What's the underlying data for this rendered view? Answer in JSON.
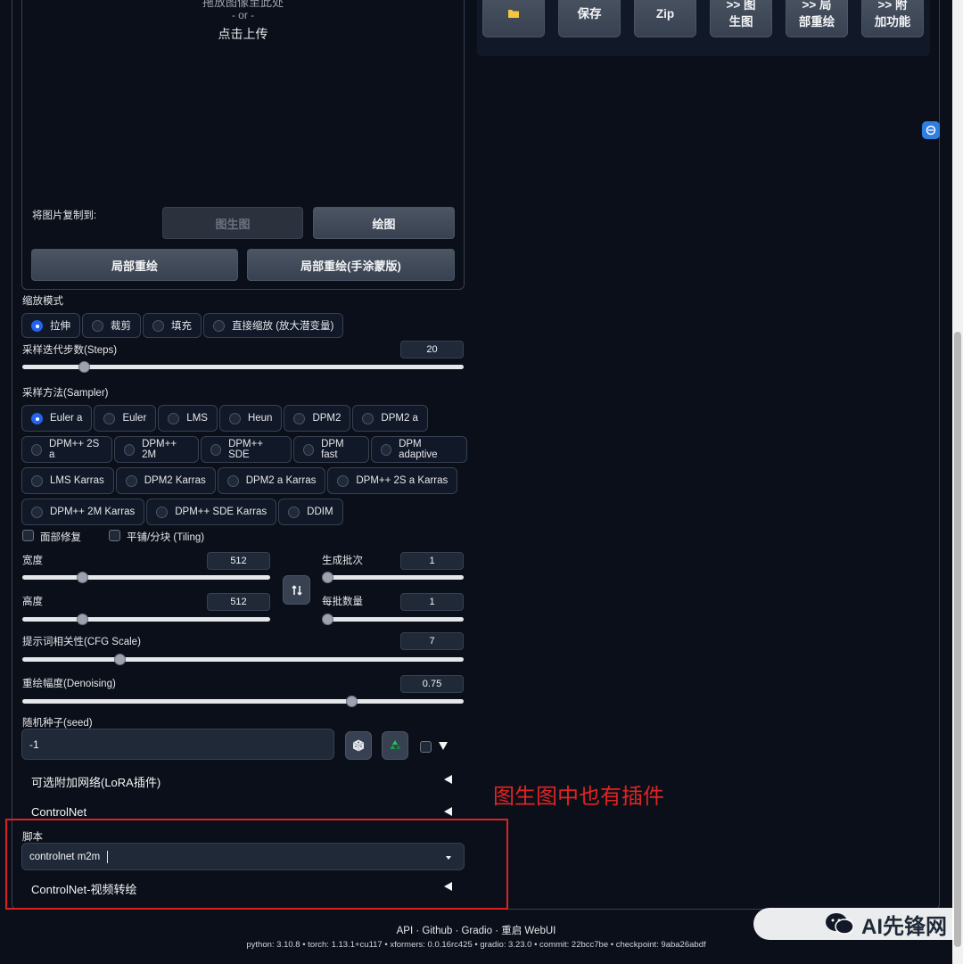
{
  "upload": {
    "hint_cut": "拖放图像至此处",
    "or": "- or -",
    "click": "点击上传",
    "copy_to_label": "将图片复制到:",
    "btn_img2img": "图生图",
    "btn_draw": "绘图",
    "btn_inpaint": "局部重绘",
    "btn_inpaint_sketch": "局部重绘(手涂蒙版)"
  },
  "right_buttons": {
    "folder_icon": "folder-icon",
    "save": "保存",
    "zip": "Zip",
    "to_img2img_1": ">> 图",
    "to_img2img_2": "生图",
    "to_inpaint_1": ">> 局",
    "to_inpaint_2": "部重绘",
    "to_extras_1": ">> 附",
    "to_extras_2": "加功能"
  },
  "resize": {
    "label": "缩放模式",
    "options": [
      "拉伸",
      "裁剪",
      "填充",
      "直接缩放 (放大潜变量)"
    ],
    "selected": "拉伸"
  },
  "steps": {
    "label": "采样迭代步数(Steps)",
    "value": "20",
    "fraction": 0.14
  },
  "sampler": {
    "label": "采样方法(Sampler)",
    "row1": [
      "Euler a",
      "Euler",
      "LMS",
      "Heun",
      "DPM2",
      "DPM2 a"
    ],
    "row2": [
      "DPM++ 2S a",
      "DPM++ 2M",
      "DPM++ SDE",
      "DPM fast",
      "DPM adaptive"
    ],
    "row3": [
      "LMS Karras",
      "DPM2 Karras",
      "DPM2 a Karras",
      "DPM++ 2S a Karras"
    ],
    "row4": [
      "DPM++ 2M Karras",
      "DPM++ SDE Karras",
      "DDIM"
    ],
    "selected": "Euler a"
  },
  "options": {
    "face_restore": "面部修复",
    "tiling": "平铺/分块 (Tiling)"
  },
  "width": {
    "label": "宽度",
    "value": "512",
    "fraction": 0.24
  },
  "height": {
    "label": "高度",
    "value": "512",
    "fraction": 0.24
  },
  "swap_icon": "swap-vertical-icon",
  "batch_count": {
    "label": "生成批次",
    "value": "1",
    "fraction": 0.0
  },
  "batch_size": {
    "label": "每批数量",
    "value": "1",
    "fraction": 0.0
  },
  "cfg": {
    "label": "提示词相关性(CFG Scale)",
    "value": "7",
    "fraction": 0.22
  },
  "denoise": {
    "label": "重绘幅度(Denoising)",
    "value": "0.75",
    "fraction": 0.745
  },
  "seed": {
    "label": "随机种子(seed)",
    "value": "-1",
    "dice_icon": "dice-icon",
    "recycle_icon": "recycle-icon"
  },
  "accordions": {
    "lora": "可选附加网络(LoRA插件)",
    "controlnet": "ControlNet"
  },
  "script": {
    "label": "脚本",
    "value": "controlnet m2m",
    "video": "ControlNet-视频转绘"
  },
  "annotation": "图生图中也有插件",
  "footer": {
    "links": "API · Github · Gradio · 重启 WebUI",
    "versions": "python: 3.10.8  •  torch: 1.13.1+cu117  •  xformers: 0.0.16rc425  •  gradio: 3.23.0  •  commit: 22bcc7be  •  checkpoint: 9aba26abdf"
  },
  "watermark": "AI先锋网",
  "colors": {
    "accent": "#2563eb",
    "annotation_red": "#d92323",
    "background": "#0b0f19"
  }
}
